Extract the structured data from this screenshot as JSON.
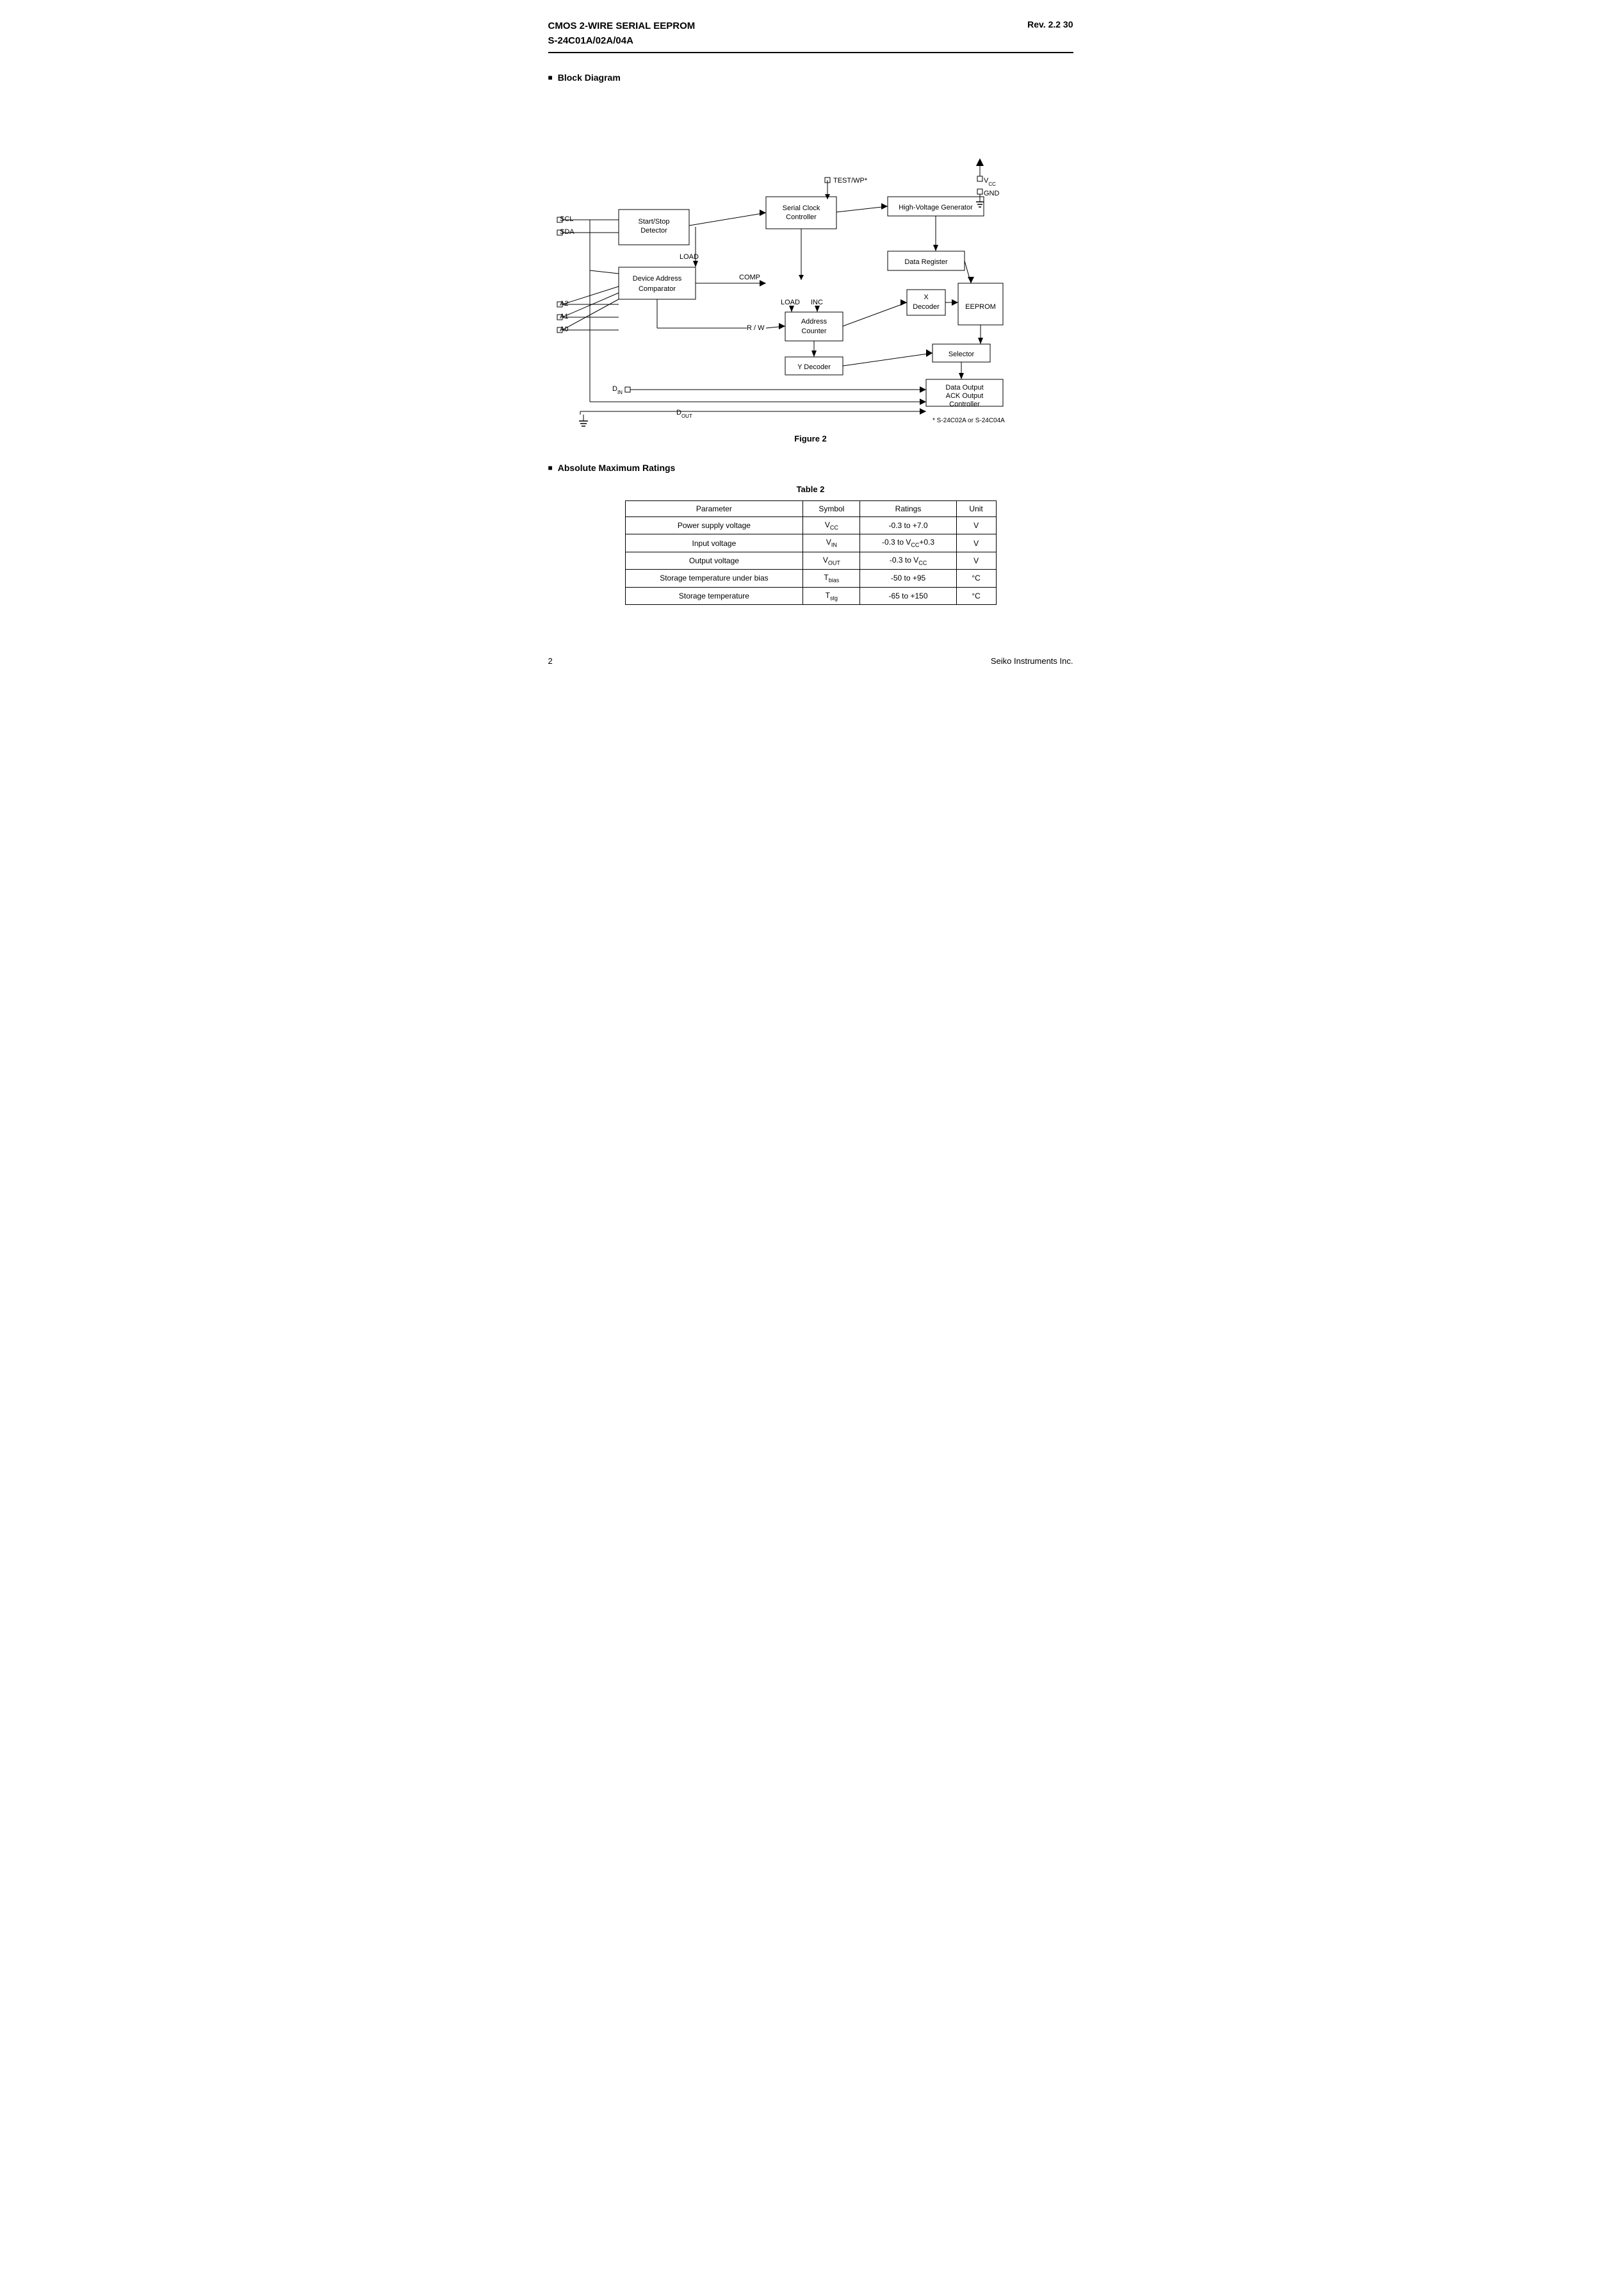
{
  "header": {
    "line1": "CMOS 2-WIRE SERIAL  EEPROM",
    "line2": "S-24C01A/02A/04A",
    "rev": "Rev. 2.2  30"
  },
  "block_diagram": {
    "section_label": "Block Diagram",
    "figure_label": "Figure 2",
    "footnote": "*   S-24C02A or S-24C04A",
    "boxes": {
      "start_stop": "Start/Stop\nDetector",
      "serial_clock": "Serial Clock\nController",
      "high_voltage": "High-Voltage Generator",
      "device_address": "Device Address\nComparator",
      "data_register": "Data Register",
      "x_decoder": "X\nDecoder",
      "eeprom": "EEPROM",
      "address_counter": "Address\nCounter",
      "y_decoder": "Y Decoder",
      "selector": "Selector",
      "data_output": "Data Output\nACK Output\nController"
    },
    "signals": {
      "SCL": "SCL",
      "SDA": "SDA",
      "A2": "A2",
      "A1": "A1",
      "A0": "A0",
      "DIN": "D",
      "DIN_sub": "IN",
      "DOUT": "D",
      "DOUT_sub": "OUT",
      "TEST_WP": "TEST/WP*",
      "VCC": "V",
      "VCC_sub": "CC",
      "GND": "GND",
      "LOAD": "LOAD",
      "COMP": "COMP",
      "LOAD2": "LOAD",
      "INC": "INC",
      "R_W": "R / W"
    }
  },
  "table": {
    "label": "Table  2",
    "headers": [
      "Parameter",
      "Symbol",
      "Ratings",
      "Unit"
    ],
    "rows": [
      [
        "Power supply voltage",
        "V_CC",
        "-0.3 to +7.0",
        "V"
      ],
      [
        "Input voltage",
        "V_IN",
        "-0.3 to V_CC+0.3",
        "V"
      ],
      [
        "Output voltage",
        "V_OUT",
        "-0.3 to V_CC",
        "V"
      ],
      [
        "Storage temperature under bias",
        "T_bias",
        "-50 to +95",
        "°C"
      ],
      [
        "Storage temperature",
        "T_stg",
        "-65 to +150",
        "°C"
      ]
    ]
  },
  "footer": {
    "page": "2",
    "company": "Seiko Instruments Inc."
  },
  "section_absolute_max": "Absolute Maximum Ratings"
}
